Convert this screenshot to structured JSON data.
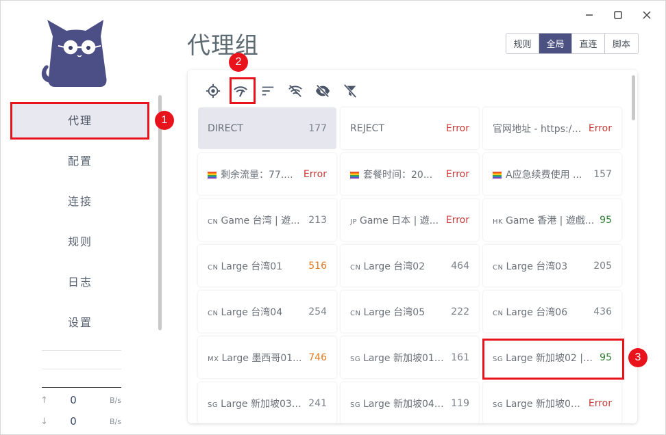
{
  "page_title": "代理组",
  "sidebar": {
    "items": [
      {
        "label": "代理",
        "active": true
      },
      {
        "label": "配置"
      },
      {
        "label": "连接"
      },
      {
        "label": "规则"
      },
      {
        "label": "日志"
      },
      {
        "label": "设置"
      }
    ]
  },
  "traffic": {
    "up": {
      "arrow": "↑",
      "value": "0",
      "unit": "B/s"
    },
    "down": {
      "arrow": "↓",
      "value": "0",
      "unit": "B/s"
    }
  },
  "modes": [
    {
      "label": "规则"
    },
    {
      "label": "全局",
      "active": true
    },
    {
      "label": "直连"
    },
    {
      "label": "脚本"
    }
  ],
  "toolbar": {
    "icons": [
      "locate-icon",
      "speed-test-icon",
      "sort-icon",
      "hide-unavailable-icon",
      "hide-icon",
      "filter-off-icon"
    ]
  },
  "proxies": [
    {
      "flag": "",
      "name": "DIRECT",
      "delay": "177",
      "color": "gray",
      "selected": true
    },
    {
      "flag": "",
      "name": "REJECT",
      "delay": "Error",
      "color": "red"
    },
    {
      "flag": "",
      "name": "官网地址 - https://...",
      "delay": "Error",
      "color": "red"
    },
    {
      "flag": "rainbow",
      "name": "剩余流量：77....",
      "delay": "Error",
      "color": "red"
    },
    {
      "flag": "rainbow",
      "name": "套餐时间：20...",
      "delay": "Error",
      "color": "red"
    },
    {
      "flag": "rainbow",
      "name": "A应急续费使用 ...",
      "delay": "157",
      "color": "gray"
    },
    {
      "flag": "CN",
      "name": "Game 台湾 | 遊...",
      "delay": "213",
      "color": "gray"
    },
    {
      "flag": "JP",
      "name": "Game 日本 | 遊...",
      "delay": "Error",
      "color": "red"
    },
    {
      "flag": "HK",
      "name": "Game 香港 | 遊戲...",
      "delay": "95",
      "color": "green"
    },
    {
      "flag": "CN",
      "name": "Large 台湾01",
      "delay": "516",
      "color": "orange"
    },
    {
      "flag": "CN",
      "name": "Large 台湾02",
      "delay": "464",
      "color": "gray"
    },
    {
      "flag": "CN",
      "name": "Large 台湾03",
      "delay": "205",
      "color": "gray"
    },
    {
      "flag": "CN",
      "name": "Large 台湾04",
      "delay": "254",
      "color": "gray"
    },
    {
      "flag": "CN",
      "name": "Large 台湾05",
      "delay": "222",
      "color": "gray"
    },
    {
      "flag": "CN",
      "name": "Large 台湾06",
      "delay": "436",
      "color": "gray"
    },
    {
      "flag": "MX",
      "name": "Large 墨西哥01...",
      "delay": "746",
      "color": "orange"
    },
    {
      "flag": "SG",
      "name": "Large 新加坡01 ...",
      "delay": "161",
      "color": "gray"
    },
    {
      "flag": "SG",
      "name": "Large 新加坡02 | ...",
      "delay": "95",
      "color": "green"
    },
    {
      "flag": "SG",
      "name": "Large 新加坡03 ...",
      "delay": "241",
      "color": "gray"
    },
    {
      "flag": "SG",
      "name": "Large 新加坡04 ...",
      "delay": "119",
      "color": "gray"
    },
    {
      "flag": "SG",
      "name": "Large 新加坡05...",
      "delay": "Error",
      "color": "red"
    }
  ],
  "annotations": [
    {
      "number": "1"
    },
    {
      "number": "2"
    },
    {
      "number": "3"
    }
  ]
}
